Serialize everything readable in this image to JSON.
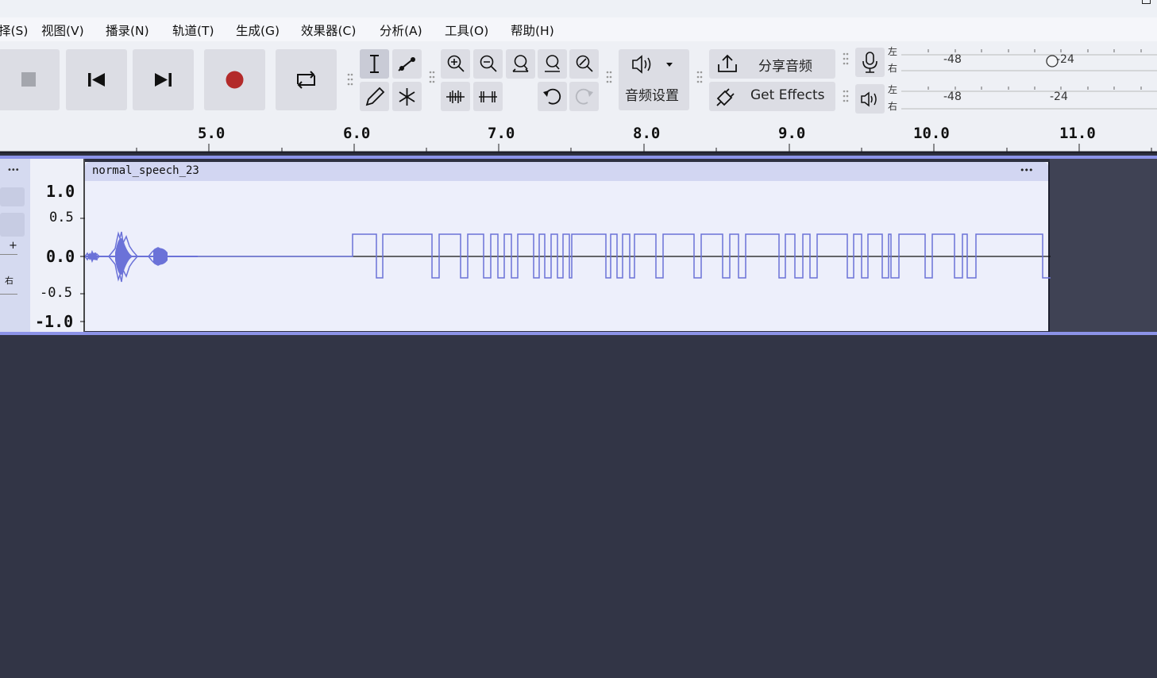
{
  "menu": {
    "items": [
      "择(S)",
      "视图(V)",
      "播录(N)",
      "轨道(T)",
      "生成(G)",
      "效果器(C)",
      "分析(A)",
      "工具(O)",
      "帮助(H)"
    ]
  },
  "toolbar": {
    "audio_setup_label": "音频设置",
    "share_audio_label": "分享音频",
    "get_effects_label": "Get Effects"
  },
  "meters": {
    "record": {
      "ch_left": "左",
      "ch_right": "右",
      "tick_a": "-48",
      "tick_b": "-24"
    },
    "playback": {
      "ch_left": "左",
      "ch_right": "右",
      "tick_a": "-48",
      "tick_b": "-24"
    }
  },
  "ruler": {
    "labels": [
      "5.0",
      "6.0",
      "7.0",
      "8.0",
      "9.0",
      "10.0",
      "11.0"
    ]
  },
  "track": {
    "menu_dots": "•••",
    "gain_plus": "+",
    "pan_label": "右",
    "clip_name": "normal_speech_23",
    "clip_menu": "•••",
    "scale_labels": [
      "1.0",
      "0.5",
      "0.0",
      "-0.5",
      "-1.0"
    ]
  },
  "colors": {
    "waveform": "#6b72d8",
    "record_dot": "#b32a2a",
    "background": "#323546"
  }
}
